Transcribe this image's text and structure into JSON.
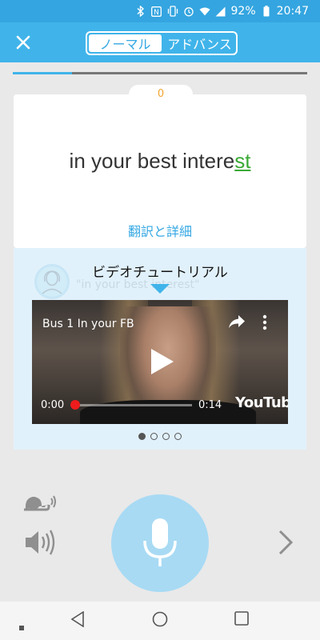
{
  "status_bar": {
    "battery_percent": "92%",
    "time": "20:47",
    "icons": [
      "bluetooth-icon",
      "nfc-icon",
      "vibrate-icon",
      "alarm-icon",
      "wifi-icon",
      "signal-icon",
      "battery-icon"
    ]
  },
  "header": {
    "close_icon": "close-icon",
    "modes": [
      "ノーマル",
      "アドバンス"
    ],
    "active_mode": "ノーマル"
  },
  "progress": {
    "value": 0.2
  },
  "phrase_card": {
    "score": "0",
    "phrase_main": "in your best intere",
    "phrase_highlight": "st",
    "translate_link": "翻訳と詳細"
  },
  "tutorial": {
    "title": "ビデオチュートリアル",
    "ghost_text": "\"in your best interest\"",
    "video": {
      "title": "Bus 1 In your FB",
      "current_time": "0:00",
      "duration": "0:14",
      "logo": "YouTube"
    },
    "pages": 4,
    "active_page": 0
  },
  "colors": {
    "accent": "#40b4ea",
    "status_bar": "#34a5e0",
    "highlight": "#3aa934",
    "score": "#f2a531",
    "mic": "#a8daf4"
  }
}
